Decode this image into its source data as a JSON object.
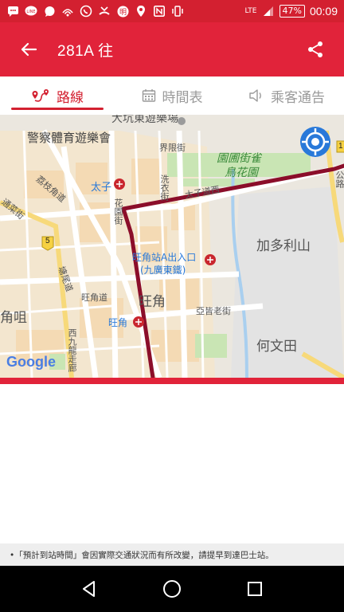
{
  "status_bar": {
    "battery": "47%",
    "clock": "00:09",
    "network": "LTE",
    "icons": [
      "sms-icon",
      "line-icon",
      "chat-icon",
      "wifi-call-icon",
      "whatsapp-icon",
      "missed-call-icon",
      "app-icon",
      "location-icon",
      "nfc-icon",
      "vibrate-icon",
      "signal-icon"
    ]
  },
  "app_bar": {
    "title": "281A 往",
    "back_icon": "arrow-left-icon",
    "share_icon": "share-icon"
  },
  "tabs": [
    {
      "label": "路線",
      "icon": "route-icon",
      "active": true
    },
    {
      "label": "時間表",
      "icon": "calendar-icon",
      "active": false
    },
    {
      "label": "乘客通告",
      "icon": "speaker-icon",
      "active": false
    }
  ],
  "map": {
    "labels": {
      "playground": "大坑東遊樂場",
      "police_sports": "警察體育遊樂會",
      "boundary_st": "界限街",
      "flower_garden_1": "園圃街雀",
      "flower_garden_2": "鳥花園",
      "tai_tsz": "太子",
      "prince_edward_rd": "太子道西",
      "sai_yee_st": "洗衣街",
      "fa_yuen_st": "花園街",
      "kadoorie_hill": "加多利山",
      "lai_chi_kok_rd": "荔枝角道",
      "tung_choi_st": "通菜街",
      "mong_kok_exit_1": "旺角站A出入口",
      "mong_kok_exit_2": "(九廣東鐵)",
      "mong_kok_rd": "旺角道",
      "mong_kok_area": "旺角",
      "mong_kok_station": "旺角",
      "ka_tak_st": "亞皆老街",
      "ho_man_tin": "何文田",
      "kok_tsui": "角咀",
      "west_kowloon": "西九龍走廊",
      "tai_kok_tsui_rd": "塘尾道",
      "road_5": "5",
      "road_1": "1",
      "right_edge": "公路",
      "google": "Google"
    }
  },
  "notice": "•「預計到站時間」會因實際交通狀況而有所改變，請提早到達巴士站。",
  "nav": {
    "back": "nav-back-icon",
    "home": "nav-home-icon",
    "recent": "nav-recent-icon"
  },
  "colors": {
    "status_bar": "#d32030",
    "app_bar": "#e1233a",
    "route": "#8b0e2a",
    "accent_blue": "#2979d9"
  }
}
